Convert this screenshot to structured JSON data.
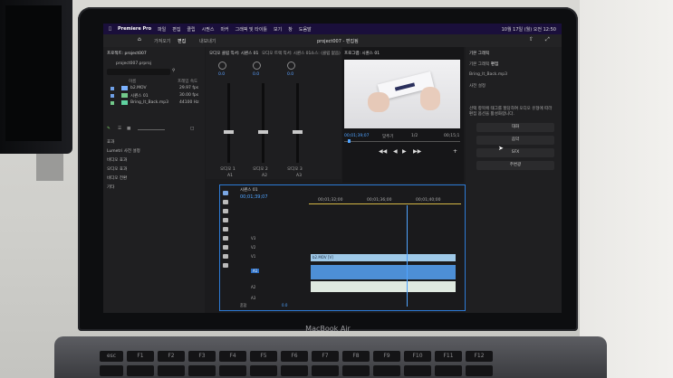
{
  "brand_label": "MacBook Air",
  "menubar": {
    "app": "Premiere Pro",
    "items": [
      "파일",
      "편집",
      "클립",
      "시퀀스",
      "마커",
      "그래픽 및 타이틀",
      "보기",
      "창",
      "도움말"
    ],
    "clock": "10월 17일 (월) 오전 12:50"
  },
  "workspaces": {
    "home_icon": "home-icon",
    "tabs": [
      "가져오기",
      "편집",
      "내보내기"
    ]
  },
  "project_title": "project007 - 편집됨",
  "project_panel": {
    "title": "프로젝트: project007",
    "file": "project007.prproj",
    "search_placeholder": "",
    "col_name": "이름",
    "col_rate": "프레임 속도",
    "items": [
      {
        "name": "b2.MOV",
        "rate": "29.97 fps"
      },
      {
        "name": "시퀀스 01",
        "rate": "30.00 fps"
      },
      {
        "name": "Bring_It_Back.mp3",
        "rate": "44100 Hz"
      }
    ],
    "sections": [
      "효과",
      "Lumetri 사전 설정",
      "비디오 효과",
      "오디오 효과",
      "비디오 전환",
      "기타"
    ]
  },
  "mixer": {
    "tabs": [
      "오디오 클립 믹서: 시퀀스 01",
      "오디오 트랙 믹서: 시퀀스 01",
      "소스: (클립 없음)"
    ],
    "channels": [
      {
        "name": "오디오 1",
        "value": "0.0"
      },
      {
        "name": "오디오 2",
        "value": "0.0"
      },
      {
        "name": "오디오 3",
        "value": "0.0"
      }
    ],
    "track_ids": [
      "A1",
      "A2",
      "A3"
    ]
  },
  "program": {
    "tab": "프로그램: 시퀀스 01",
    "timecode": "00;01;39;07",
    "fit": "맞추기",
    "zoom": "1/2",
    "end_timecode": "00;15;1"
  },
  "right_panel": {
    "tabs": [
      "기본 그래픽",
      "편집"
    ],
    "file": "Bring_It_Back.mp3",
    "preset": "사전 설정",
    "info": "선택 항목에 태그를 할당하여 오디오 유형에 따라 편집 옵션을 활성화합니다.",
    "buttons": [
      "대화",
      "음악",
      "SFX",
      "주변광"
    ]
  },
  "timeline": {
    "tab": "시퀀스 01",
    "timecode": "00;01;39;07",
    "ruler": [
      "00;01;32;00",
      "00;01;36;00",
      "00;01;40;00"
    ],
    "video_tracks": [
      "V3",
      "V2",
      "V1"
    ],
    "audio_tracks": [
      "A1",
      "A2",
      "A3"
    ],
    "master": "혼합",
    "master_value": "0.0",
    "clip_name": "b2.MOV [V]"
  },
  "keyboard_row": [
    "esc",
    "F1",
    "F2",
    "F3",
    "F4",
    "F5",
    "F6",
    "F7",
    "F8",
    "F9",
    "F10",
    "F11",
    "F12"
  ]
}
